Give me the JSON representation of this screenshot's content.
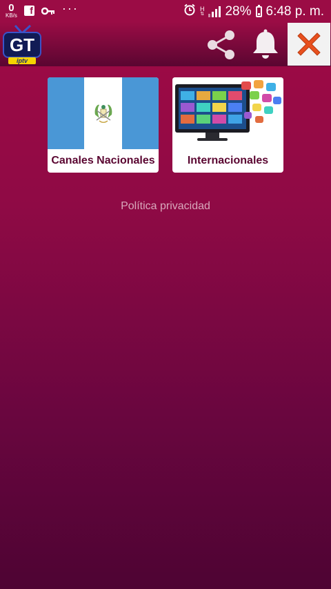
{
  "status_bar": {
    "data_rate": "0",
    "data_unit": "KB/s",
    "network": "H",
    "battery": "28%",
    "time": "6:48 p. m."
  },
  "app_bar": {
    "logo_text": "GT",
    "logo_subtext": "iptv",
    "share_icon": "share-icon",
    "bell_icon": "bell-icon",
    "close_icon": "close-icon"
  },
  "categories": [
    {
      "label": "Canales Nacionales",
      "image": "guatemala-flag"
    },
    {
      "label": "Internacionales",
      "image": "tv-apps"
    }
  ],
  "privacy_link": "Política privacidad",
  "colors": {
    "background_top": "#a10a45",
    "background_bottom": "#4e0433",
    "card_label": "#5a0631",
    "close_x": "#e8501e"
  }
}
